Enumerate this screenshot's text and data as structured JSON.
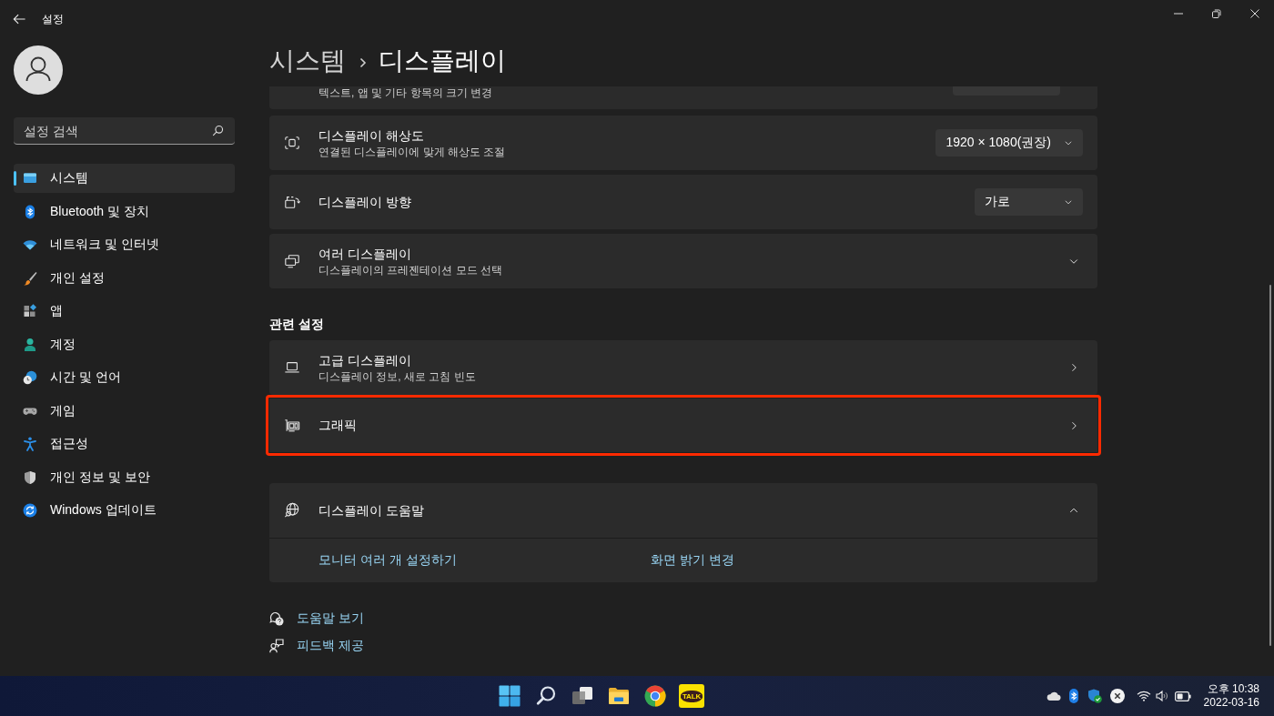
{
  "window": {
    "title": "설정"
  },
  "sidebar": {
    "search": {
      "placeholder": "설정 검색"
    },
    "items": [
      {
        "label": "시스템",
        "selected": true
      },
      {
        "label": "Bluetooth 및 장치",
        "selected": false
      },
      {
        "label": "네트워크 및 인터넷",
        "selected": false
      },
      {
        "label": "개인 설정",
        "selected": false
      },
      {
        "label": "앱",
        "selected": false
      },
      {
        "label": "계정",
        "selected": false
      },
      {
        "label": "시간 및 언어",
        "selected": false
      },
      {
        "label": "게임",
        "selected": false
      },
      {
        "label": "접근성",
        "selected": false
      },
      {
        "label": "개인 정보 및 보안",
        "selected": false
      },
      {
        "label": "Windows 업데이트",
        "selected": false
      }
    ]
  },
  "breadcrumb": [
    {
      "label": "시스템"
    },
    {
      "label": "디스플레이"
    }
  ],
  "settings_rows": [
    {
      "kind": "partial",
      "description": "텍스트, 앱 및 기타 항목의 크기 변경"
    },
    {
      "kind": "dropdown",
      "title": "디스플레이 해상도",
      "description": "연결된 디스플레이에 맞게 해상도 조절",
      "value": "1920 × 1080(권장)"
    },
    {
      "kind": "dropdown",
      "title": "디스플레이 방향",
      "value": "가로"
    },
    {
      "kind": "expander",
      "title": "여러 디스플레이",
      "description": "디스플레이의 프레젠테이션 모드 선택",
      "expanded": false
    }
  ],
  "related_settings": {
    "heading": "관련 설정",
    "rows": [
      {
        "title": "고급 디스플레이",
        "description": "디스플레이 정보, 새로 고침 빈도",
        "highlighted": false
      },
      {
        "title": "그래픽",
        "highlighted": true
      }
    ]
  },
  "help_section": {
    "title": "디스플레이 도움말",
    "expanded": true,
    "links": [
      "모니터 여러 개 설정하기",
      "화면 밝기 변경"
    ]
  },
  "footer_links": [
    {
      "label": "도움말 보기"
    },
    {
      "label": "피드백 제공"
    }
  ],
  "taskbar": {
    "messenger_logo_text": "TALK",
    "clock": {
      "time": "오후 10:38",
      "date": "2022-03-16"
    }
  }
}
